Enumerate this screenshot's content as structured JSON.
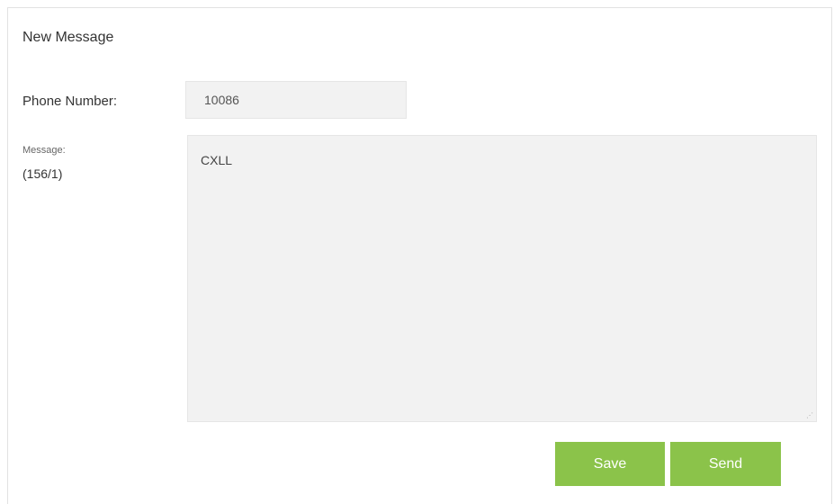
{
  "dialog": {
    "title": "New Message",
    "phone_label": "Phone Number:",
    "phone_value": "10086",
    "message_label": "Message:",
    "char_count": "(156/1)",
    "message_value": "CXLL",
    "save_label": "Save",
    "send_label": "Send"
  },
  "colors": {
    "button_bg": "#8bc34a",
    "field_bg": "#f2f2f2",
    "border": "#e2e2e2"
  }
}
